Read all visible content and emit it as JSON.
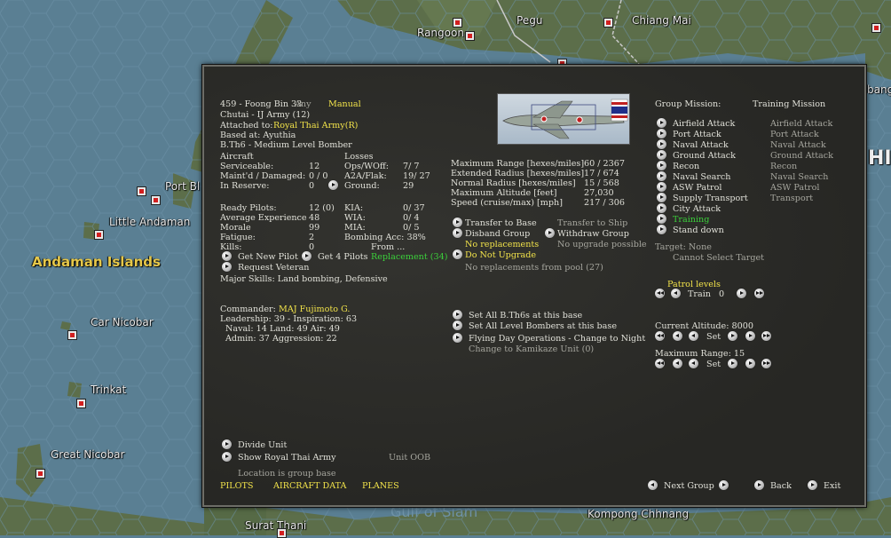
{
  "map": {
    "labels": {
      "rangoon": "Rangoon",
      "pegu": "Pegu",
      "chiang_mai": "Chiang Mai",
      "port_blair": "Port Bl",
      "little_andaman": "Little Andaman",
      "andaman_islands": "Andaman Islands",
      "car_nicobar": "Car Nicobar",
      "trinkat": "Trinkat",
      "great_nicobar": "Great Nicobar",
      "surat_thani": "Surat Thani",
      "kompong_chhnang": "Kompong Chhnang",
      "gulf_of_siam": "Gulf of Siam",
      "bang": "bang",
      "hi": "HI"
    }
  },
  "unit": {
    "header": "459 - Foong Bin 33",
    "any": "Any",
    "manual": "Manual",
    "hq_line": "Chutai - IJ Army (12)",
    "attached_label": "Attached to:",
    "attached_value": "Royal Thai Army(R)",
    "based_at": "Based at: Ayuthia",
    "aircraft_type": "B.Th6 - Medium Level Bomber"
  },
  "aircraft": {
    "heading": "Aircraft",
    "serviceable_label": "Serviceable:",
    "serviceable": "12",
    "maintd_label": "Maint'd / Damaged:",
    "maintd": "0 / 0",
    "reserve_label": "In Reserve:",
    "reserve": "0"
  },
  "losses": {
    "heading": "Losses",
    "ops_label": "Ops/WOff:",
    "ops": "7/ 7",
    "a2a_label": "A2A/Flak:",
    "a2a": "19/ 27",
    "ground_label": "Ground:",
    "ground": "29"
  },
  "pilots": {
    "ready_label": "Ready Pilots:",
    "ready": "12 (0)",
    "exp_label": "Average Experience",
    "exp": "48",
    "morale_label": "Morale",
    "morale": "99",
    "fatigue_label": "Fatigue:",
    "fatigue": "2",
    "kills_label": "Kills:",
    "kills": "0",
    "kia_label": "KIA:",
    "kia": "0/ 37",
    "wia_label": "WIA:",
    "wia": "0/ 4",
    "mia_label": "MIA:",
    "mia": "0/ 5",
    "bombing_acc": "Bombing Acc: 38%",
    "from": "From ...",
    "get_new_pilot": "Get New Pilot",
    "get_4_pilots": "Get 4 Pilots",
    "replacement": "Replacement (34)",
    "request_veteran": "Request Veteran",
    "major_skills": "Major Skills:  Land bombing, Defensive"
  },
  "commander": {
    "label": "Commander:",
    "name": "MAJ Fujimoto G.",
    "leadership": "Leadership: 39 - Inspiration: 63",
    "naval": "Naval:  14   Land:  49   Air:  49",
    "admin": "Admin:  37   Aggression:  22"
  },
  "specs": {
    "max_range_label": "Maximum Range [hexes/miles]",
    "max_range": "60 / 2367",
    "ext_radius_label": "Extended Radius [hexes/miles]",
    "ext_radius": "17 / 674",
    "norm_radius_label": "Normal Radius [hexes/miles]",
    "norm_radius": "15 / 568",
    "max_alt_label": "Maximum Altitude [feet]",
    "max_alt": "27,030",
    "speed_label": "Speed (cruise/max) [mph]",
    "speed": "217 / 306"
  },
  "actions": {
    "transfer_to_base": "Transfer to Base",
    "transfer_to_ship": "Transfer to Ship",
    "disband_group": "Disband Group",
    "withdraw_group": "Withdraw Group",
    "no_replacements": "No replacements",
    "no_upgrade_possible": "No upgrade possible",
    "do_not_upgrade": "Do Not Upgrade",
    "no_repl_pool": "No replacements from pool (27)",
    "set_all_bth6": "Set All B.Th6s at this base",
    "set_all_level": "Set All Level Bombers at this base",
    "flying_day": "Flying Day Operations - Change to Night",
    "kamikaze": "Change to Kamikaze Unit (0)"
  },
  "mission": {
    "group_mission_label": "Group Mission:",
    "current": "Training Mission",
    "items": [
      {
        "label": "Airfield Attack",
        "alt": "Airfield Attack"
      },
      {
        "label": "Port Attack",
        "alt": "Port Attack"
      },
      {
        "label": "Naval Attack",
        "alt": "Naval Attack"
      },
      {
        "label": "Ground Attack",
        "alt": "Ground Attack"
      },
      {
        "label": "Recon",
        "alt": "Recon"
      },
      {
        "label": "Naval Search",
        "alt": "Naval Search"
      },
      {
        "label": "ASW Patrol",
        "alt": "ASW Patrol"
      },
      {
        "label": "Supply Transport",
        "alt": "Transport"
      },
      {
        "label": "City Attack",
        "alt": ""
      },
      {
        "label": "Training",
        "alt": ""
      },
      {
        "label": "Stand down",
        "alt": ""
      }
    ],
    "target": "Target: None",
    "cannot_select": "Cannot Select Target",
    "patrol_levels": "Patrol levels",
    "train": "Train",
    "train_value": "0",
    "current_alt": "Current Altitude: 8000",
    "set": "Set",
    "max_range": "Maximum Range: 15"
  },
  "footer": {
    "divide_unit": "Divide Unit",
    "show_army": "Show Royal Thai Army",
    "unit_oob": "Unit OOB",
    "location": "Location is group base",
    "pilots": "PILOTS",
    "aircraft_data": "AIRCRAFT DATA",
    "planes": "PLANES",
    "next_group": "Next Group",
    "back": "Back",
    "exit": "Exit"
  }
}
